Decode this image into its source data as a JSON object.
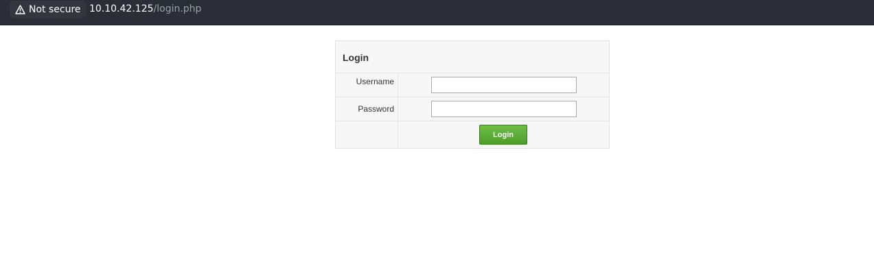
{
  "browser": {
    "security_label": "Not secure",
    "icon": "warning-triangle-icon",
    "url_host": "10.10.42.125",
    "url_path": "/login.php"
  },
  "login_form": {
    "title": "Login",
    "fields": [
      {
        "label": "Username",
        "value": "",
        "placeholder": ""
      },
      {
        "label": "Password",
        "value": "",
        "placeholder": ""
      }
    ],
    "submit_label": "Login",
    "colors": {
      "button": "#5aae33",
      "table_bg": "#f7f7f7",
      "border": "#e2e2e2"
    }
  }
}
